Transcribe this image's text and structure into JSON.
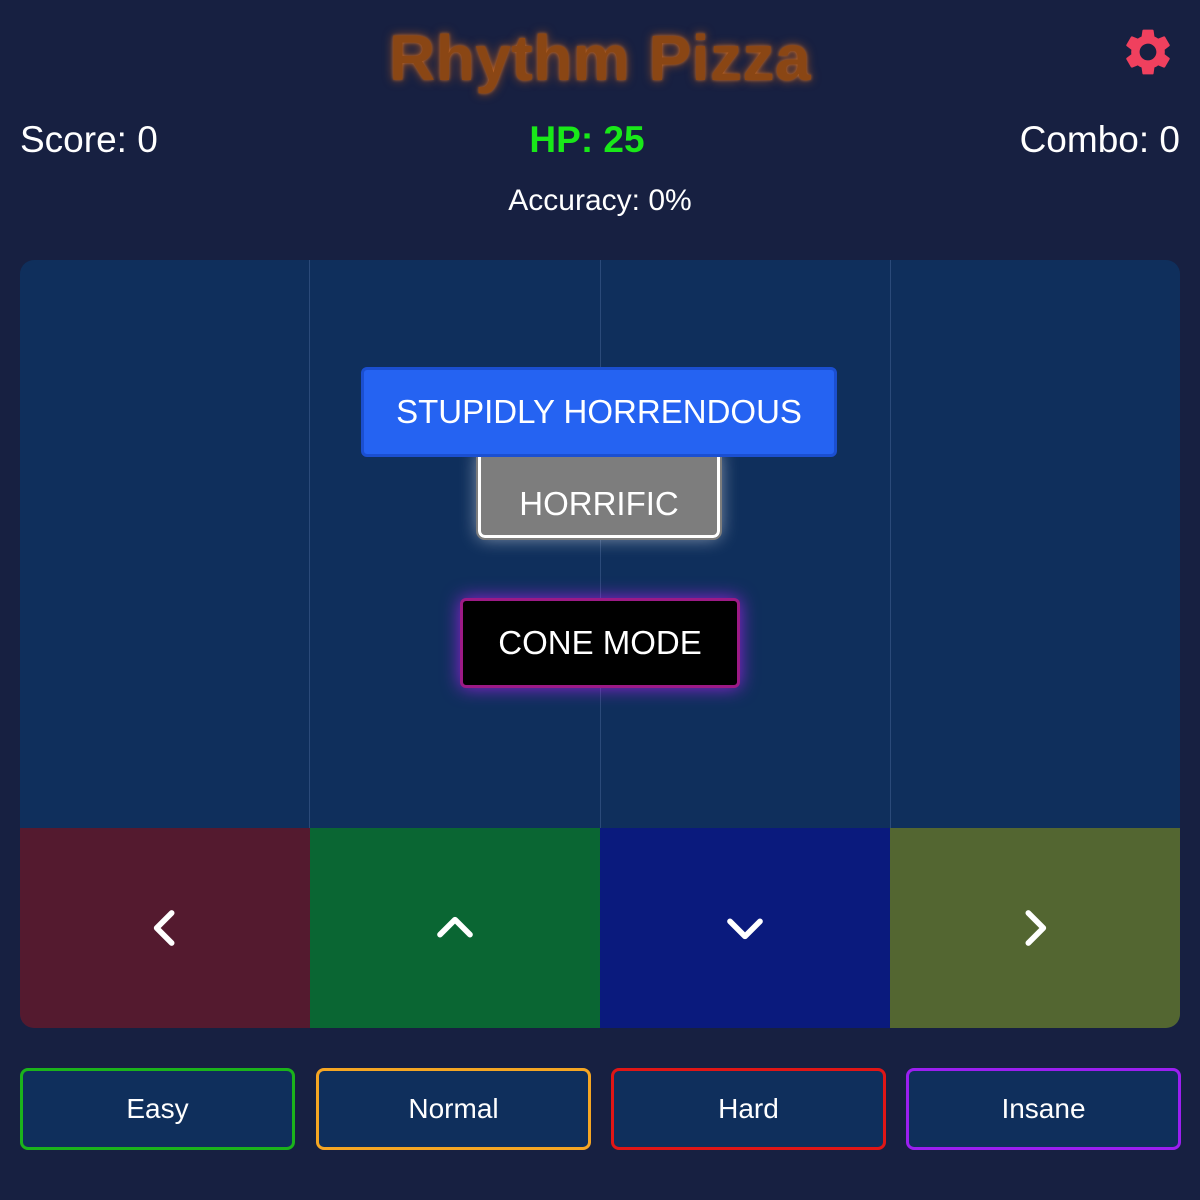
{
  "header": {
    "title": "Rhythm Pizza",
    "settings_icon": "gear-icon"
  },
  "stats": {
    "score": "Score: 0",
    "hp": "HP: 25",
    "combo": "Combo: 0",
    "accuracy": "Accuracy: 0%"
  },
  "board": {
    "judgements": {
      "top": "STUPIDLY HORRENDOUS",
      "under": "HORRIFIC"
    },
    "mode_badge": "CONE MODE",
    "pads": [
      {
        "direction": "left",
        "icon": "chevron-left-icon",
        "color": "#541a2f"
      },
      {
        "direction": "up",
        "icon": "chevron-up-icon",
        "color": "#0a6633"
      },
      {
        "direction": "down",
        "icon": "chevron-down-icon",
        "color": "#0a1a7d"
      },
      {
        "direction": "right",
        "icon": "chevron-right-icon",
        "color": "#536631"
      }
    ]
  },
  "difficulty": {
    "options": [
      {
        "label": "Easy",
        "color": "#1bb31b"
      },
      {
        "label": "Normal",
        "color": "#f5a623"
      },
      {
        "label": "Hard",
        "color": "#e01616"
      },
      {
        "label": "Insane",
        "color": "#9b1ff0"
      }
    ]
  },
  "colors": {
    "background": "#172041",
    "board": "#0f2f5c",
    "title": "#8a4614",
    "hp": "#19e819",
    "gear": "#f0405e",
    "judgement_top": "#2563f2",
    "judgement_under": "#7d7d7d",
    "mode_glow": "#9c1a86"
  }
}
